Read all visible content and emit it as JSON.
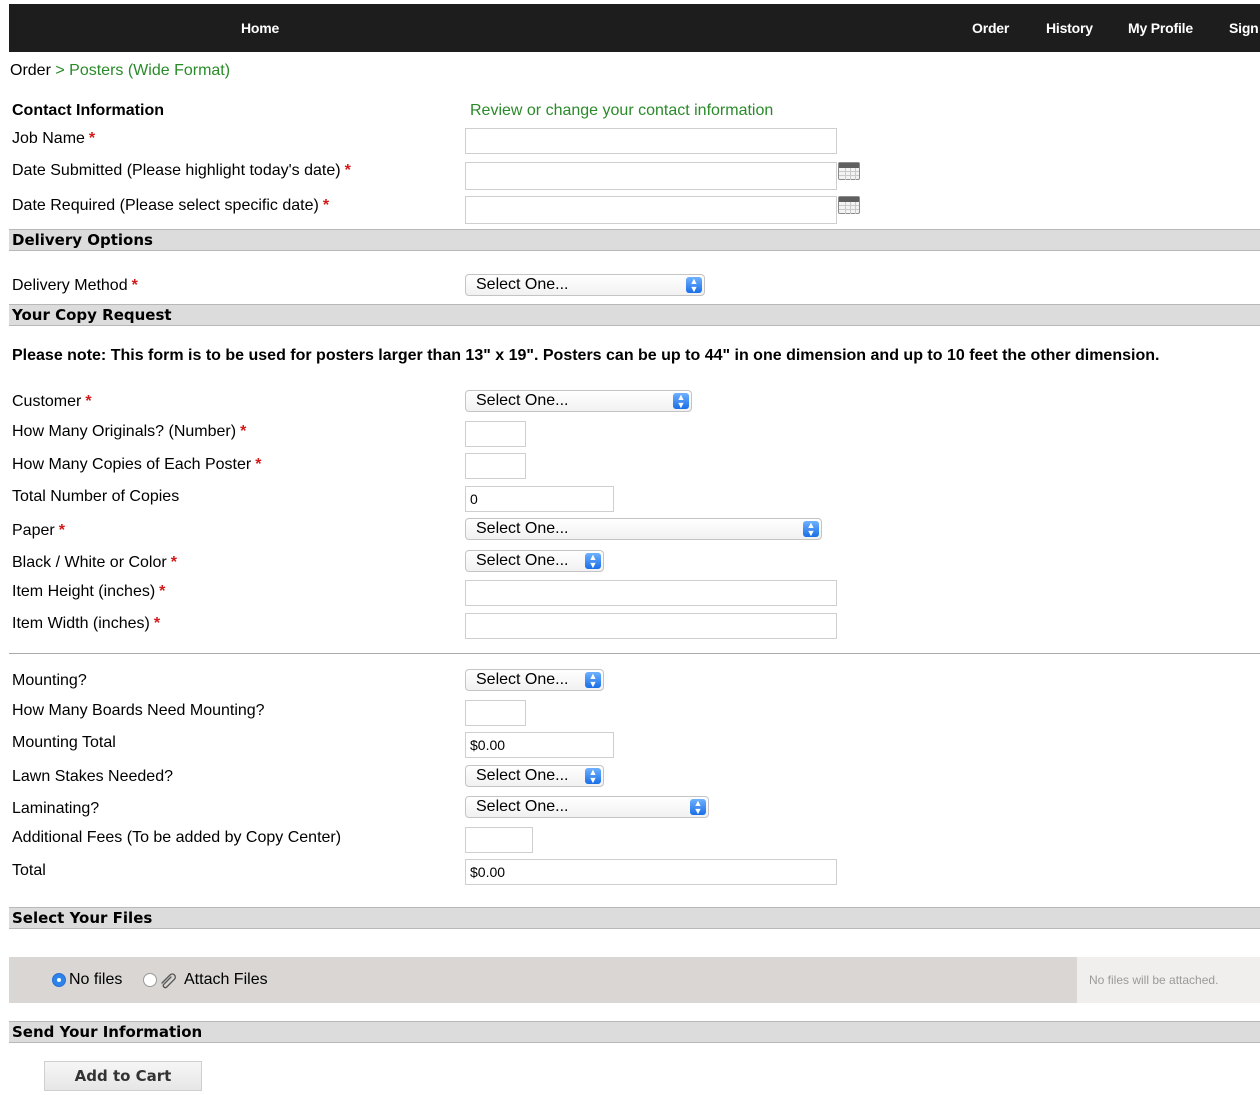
{
  "nav": {
    "home": "Home",
    "order": "Order",
    "history": "History",
    "profile": "My Profile",
    "sign": "Sign"
  },
  "breadcrumb": {
    "root": "Order",
    "current": "> Posters (Wide Format)"
  },
  "contact": {
    "heading": "Contact Information",
    "review_link": "Review or change your contact information",
    "job_name_label": "Job Name",
    "date_submitted_label": "Date Submitted (Please highlight today's date)",
    "date_required_label": "Date Required (Please select specific date)"
  },
  "required_mark": "*",
  "delivery": {
    "heading": "Delivery Options",
    "method_label": "Delivery Method",
    "method_value": "Select One..."
  },
  "copy_request": {
    "heading": "Your Copy Request",
    "note": "Please note: This form is to be used for posters larger than 13\" x 19\". Posters can be up to 44\" in one dimension and up to 10 feet the other dimension.",
    "customer_label": "Customer",
    "customer_value": "Select One...",
    "originals_label": "How Many Originals? (Number)",
    "copies_label": "How Many Copies of Each Poster",
    "total_copies_label": "Total Number of Copies",
    "total_copies_value": "0",
    "paper_label": "Paper",
    "paper_value": "Select One...",
    "color_label": "Black / White or Color",
    "color_value": "Select One...",
    "height_label": "Item Height (inches)",
    "width_label": "Item Width (inches)",
    "mounting_label": "Mounting?",
    "mounting_value": "Select One...",
    "boards_label": "How Many Boards Need Mounting?",
    "mounting_total_label": "Mounting Total",
    "mounting_total_value": "$0.00",
    "lawn_label": "Lawn Stakes Needed?",
    "lawn_value": "Select One...",
    "laminating_label": "Laminating?",
    "laminating_value": "Select One...",
    "fees_label": "Additional Fees (To be added by Copy Center)",
    "total_label": "Total",
    "total_value": "$0.00"
  },
  "files": {
    "heading": "Select Your Files",
    "no_files": "No files",
    "attach_files": "Attach Files",
    "status": "No files will be attached.",
    "selected": "No files"
  },
  "send": {
    "heading": "Send Your Information",
    "add_to_cart": "Add to Cart"
  },
  "colors": {
    "nav_bg": "#1d1d1d",
    "link_green": "#2a8a2a",
    "required_red": "#d21a1a",
    "section_bg": "#dcdcdc",
    "select_blue": "#2c83ea"
  },
  "icons": {
    "calendar": "calendar-icon",
    "select_arrows": "select-arrows-icon",
    "paperclip": "paperclip-icon"
  }
}
